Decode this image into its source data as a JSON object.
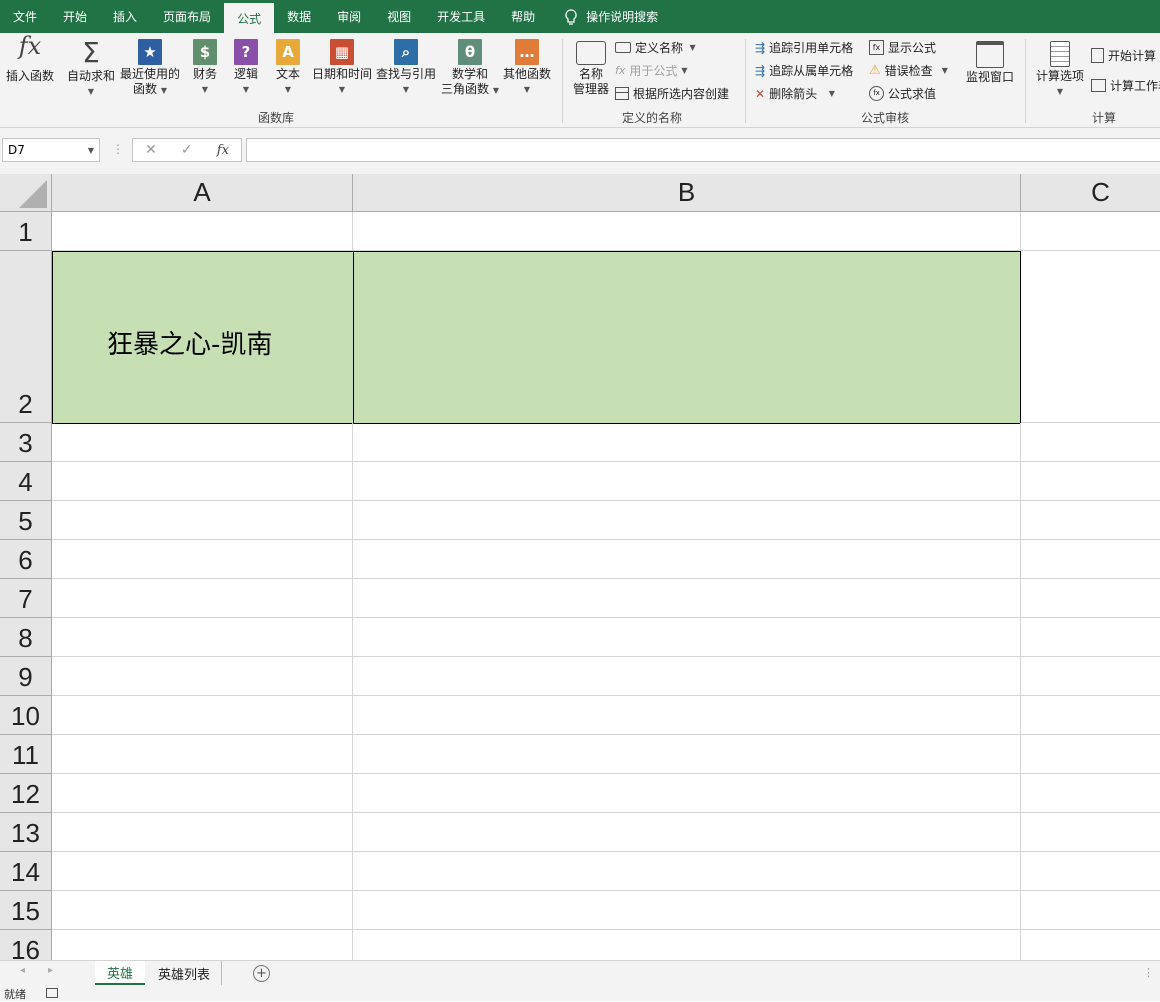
{
  "ribbon_tabs": [
    "文件",
    "开始",
    "插入",
    "页面布局",
    "公式",
    "数据",
    "审阅",
    "视图",
    "开发工具",
    "帮助"
  ],
  "active_tab": "公式",
  "tell_me": "操作说明搜索",
  "groups": {
    "function_library": {
      "label": "函数库",
      "insert_function": "插入函数",
      "autosum": "自动求和",
      "recent_1": "最近使用的",
      "recent_2": "函数",
      "financial": "财务",
      "logical": "逻辑",
      "text": "文本",
      "datetime": "日期和时间",
      "lookup": "查找与引用",
      "math_1": "数学和",
      "math_2": "三角函数",
      "more": "其他函数"
    },
    "defined_names": {
      "label": "定义的名称",
      "name_manager_1": "名称",
      "name_manager_2": "管理器",
      "define_name": "定义名称",
      "use_in_formula": "用于公式",
      "create_from_selection": "根据所选内容创建"
    },
    "formula_auditing": {
      "label": "公式审核",
      "trace_precedents": "追踪引用单元格",
      "trace_dependents": "追踪从属单元格",
      "remove_arrows": "删除箭头",
      "show_formulas": "显示公式",
      "error_checking": "错误检查",
      "evaluate_formula": "公式求值",
      "watch_window": "监视窗口"
    },
    "calculation": {
      "label": "计算",
      "calc_options": "计算选项",
      "calc_now": "开始计算",
      "calc_sheet": "计算工作表"
    }
  },
  "formula_bar": {
    "name_box": "D7",
    "fx": "fx",
    "formula": ""
  },
  "columns": [
    "A",
    "B",
    "C"
  ],
  "rows": [
    "1",
    "2",
    "3",
    "4",
    "5",
    "6",
    "7",
    "8",
    "9",
    "10",
    "11",
    "12",
    "13",
    "14",
    "15",
    "16"
  ],
  "cells": {
    "A2": "狂暴之心-凯南",
    "B2": ""
  },
  "colors": {
    "accent": "#217346",
    "cell_fill": "#c6e0b4"
  },
  "sheet_tabs": [
    "英雄",
    "英雄列表"
  ],
  "active_sheet": "英雄",
  "status": "就绪"
}
